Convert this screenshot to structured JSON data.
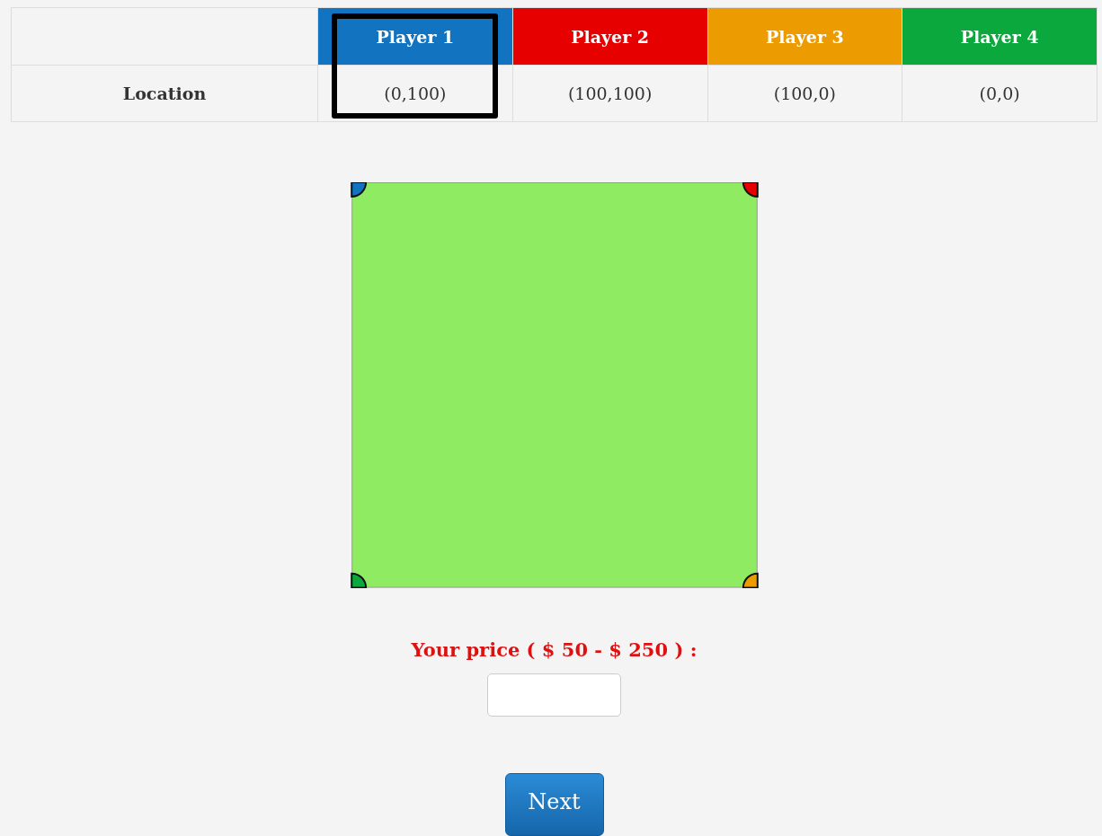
{
  "table": {
    "row_label": "Location",
    "players": [
      {
        "name": "Player 1",
        "location": "(0,100)",
        "color": "#1273c1",
        "kind": "topleft",
        "highlighted": true
      },
      {
        "name": "Player 2",
        "location": "(100,100)",
        "color": "#e60000",
        "kind": "topright",
        "highlighted": false
      },
      {
        "name": "Player 3",
        "location": "(100,0)",
        "color": "#ec9c00",
        "kind": "bottomright",
        "highlighted": false
      },
      {
        "name": "Player 4",
        "location": "(0,0)",
        "color": "#0aa83d",
        "kind": "bottomleft",
        "highlighted": false
      }
    ]
  },
  "price": {
    "label": "Your price ( $ 50 - $ 250 ) :"
  },
  "buttons": [
    {
      "label": "Next"
    }
  ]
}
